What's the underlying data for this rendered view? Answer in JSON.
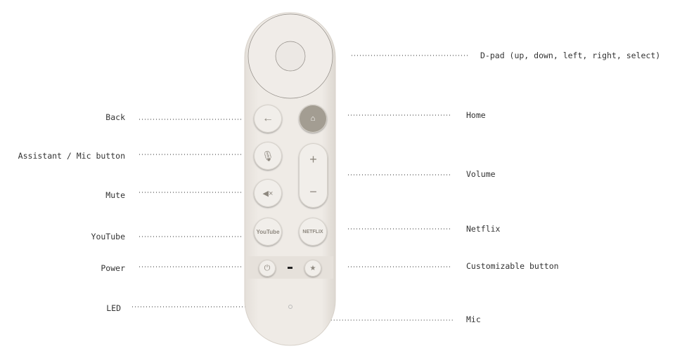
{
  "labels_left": {
    "back": "Back",
    "assistant": "Assistant / Mic button",
    "mute": "Mute",
    "youtube": "YouTube",
    "power": "Power",
    "led": "LED"
  },
  "labels_right": {
    "dpad": "D-pad (up, down, left, right, select)",
    "home": "Home",
    "volume": "Volume",
    "netflix": "Netflix",
    "custom": "Customizable button",
    "mic": "Mic"
  },
  "remote": {
    "youtube_text": "YouTube",
    "netflix_text": "NETFLIX",
    "vol_plus": "+",
    "vol_minus": "−",
    "color_body": "#ece8e3",
    "color_home": "#a39d92"
  }
}
